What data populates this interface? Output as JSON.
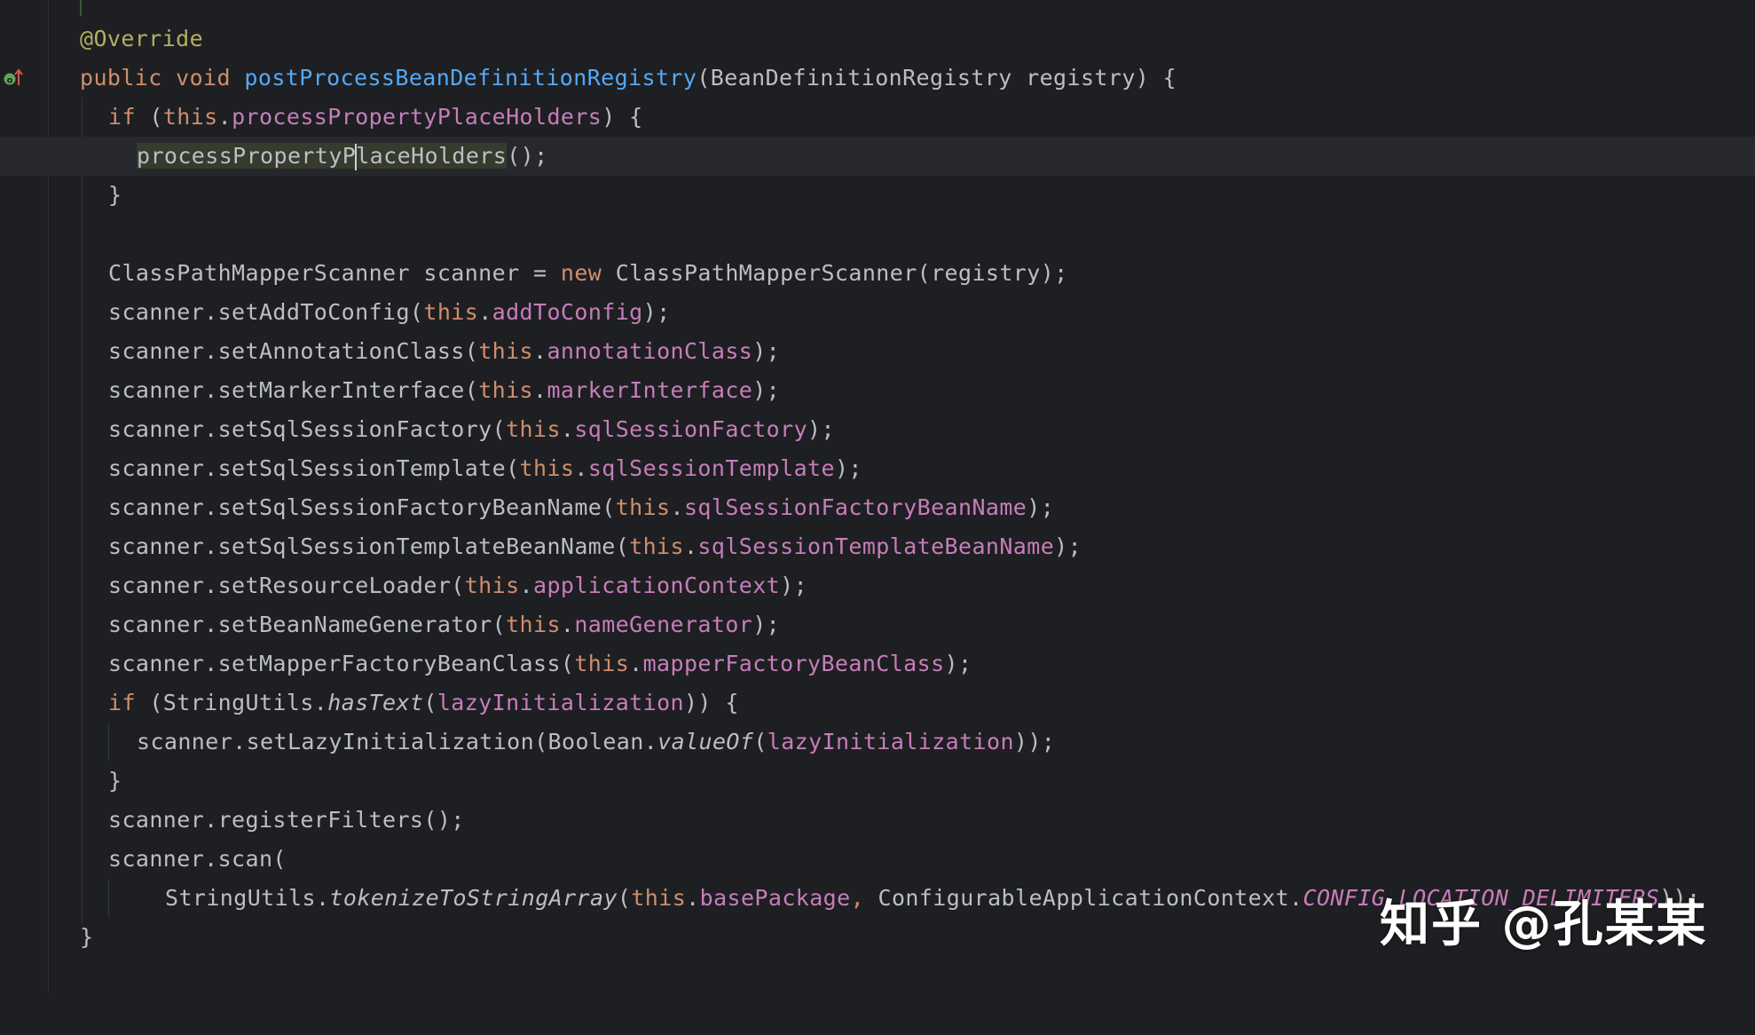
{
  "watermark": "知乎 @孔某某",
  "icons": {
    "gutter_override": "override-up-arrow-icon",
    "intention_action": "lightbulb-icon"
  },
  "colors": {
    "background": "#1e1f22",
    "current_line": "#26282e",
    "keyword": "#cf8e6d",
    "annotation": "#b3ae60",
    "method_declaration": "#56a8f5",
    "field": "#c77dbb",
    "default_text": "#bcbec4"
  },
  "code": {
    "annotation": "@Override",
    "signature": {
      "mod": "public void ",
      "name": "postProcessBeanDefinitionRegistry",
      "params": "(BeanDefinitionRegistry registry) {"
    },
    "if1": {
      "kw": "if",
      "open": " (",
      "this": "this",
      "dot": ".",
      "field": "processPropertyPlaceHolders",
      "close": ") {"
    },
    "call1": {
      "pre": "processPropertyP",
      "post": "laceHolders",
      "tail": "();"
    },
    "close_brace": "}",
    "scanner_decl": {
      "a": "ClassPathMapperScanner scanner = ",
      "kw": "new",
      "b": " ClassPathMapperScanner(registry);"
    },
    "setters": [
      {
        "method": "scanner.setAddToConfig(",
        "this": "this",
        "field": "addToConfig",
        "end": ");"
      },
      {
        "method": "scanner.setAnnotationClass(",
        "this": "this",
        "field": "annotationClass",
        "end": ");"
      },
      {
        "method": "scanner.setMarkerInterface(",
        "this": "this",
        "field": "markerInterface",
        "end": ");"
      },
      {
        "method": "scanner.setSqlSessionFactory(",
        "this": "this",
        "field": "sqlSessionFactory",
        "end": ");"
      },
      {
        "method": "scanner.setSqlSessionTemplate(",
        "this": "this",
        "field": "sqlSessionTemplate",
        "end": ");"
      },
      {
        "method": "scanner.setSqlSessionFactoryBeanName(",
        "this": "this",
        "field": "sqlSessionFactoryBeanName",
        "end": ");"
      },
      {
        "method": "scanner.setSqlSessionTemplateBeanName(",
        "this": "this",
        "field": "sqlSessionTemplateBeanName",
        "end": ");"
      },
      {
        "method": "scanner.setResourceLoader(",
        "this": "this",
        "field": "applicationContext",
        "end": ");"
      },
      {
        "method": "scanner.setBeanNameGenerator(",
        "this": "this",
        "field": "nameGenerator",
        "end": ");"
      },
      {
        "method": "scanner.setMapperFactoryBeanClass(",
        "this": "this",
        "field": "mapperFactoryBeanClass",
        "end": ");"
      }
    ],
    "if2": {
      "kw": "if",
      "a": " (StringUtils.",
      "m": "hasText",
      "b": "(",
      "field": "lazyInitialization",
      "c": ")) {"
    },
    "lazy": {
      "a": "scanner.setLazyInitialization(Boolean.",
      "m": "valueOf",
      "b": "(",
      "field": "lazyInitialization",
      "c": "));"
    },
    "register": "scanner.registerFilters();",
    "scan": "scanner.scan(",
    "tokenize": {
      "a": "StringUtils.",
      "m": "tokenizeToStringArray",
      "b": "(",
      "this": "this",
      "dot": ".",
      "field": "basePackage",
      "comma": ", ",
      "c": "ConfigurableApplicationContext.",
      "const": "CONFIG_LOCATION_DELIMITERS",
      "end": "));"
    },
    "method_close": "}"
  }
}
